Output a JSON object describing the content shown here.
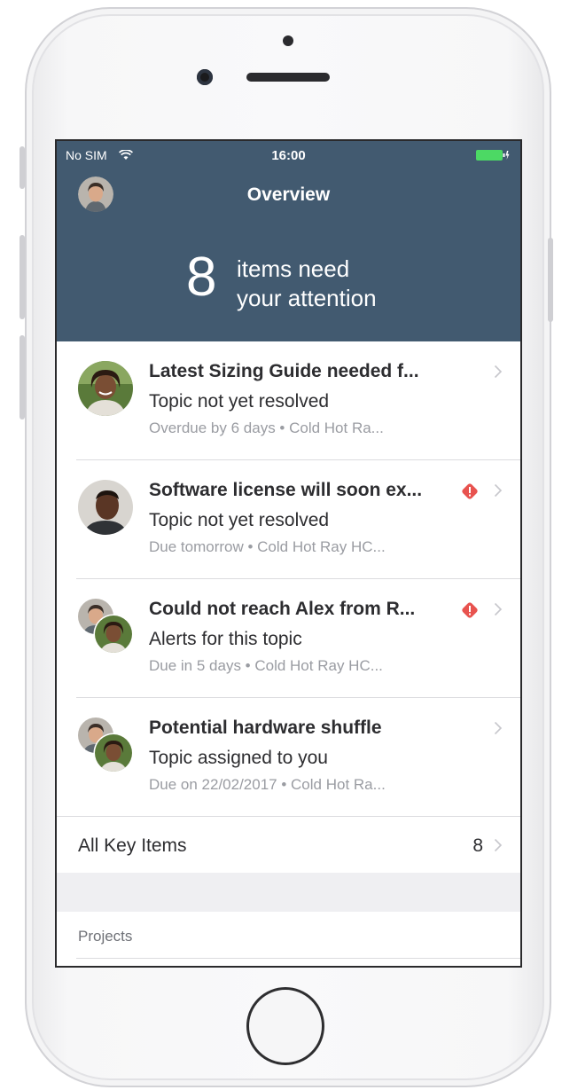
{
  "status_bar": {
    "carrier": "No SIM",
    "time": "16:00"
  },
  "nav": {
    "title": "Overview"
  },
  "attention": {
    "count": "8",
    "line1": "items need",
    "line2": "your attention"
  },
  "items": [
    {
      "title": "Latest Sizing Guide needed f...",
      "subtitle": "Topic not yet resolved",
      "meta": "Overdue by 6 days • Cold Hot Ra...",
      "alert": false
    },
    {
      "title": "Software license will soon ex...",
      "subtitle": "Topic not yet resolved",
      "meta": "Due tomorrow • Cold Hot Ray HC...",
      "alert": true
    },
    {
      "title": "Could not reach Alex from R...",
      "subtitle": "Alerts for this topic",
      "meta": "Due in 5 days • Cold Hot Ray HC...",
      "alert": true
    },
    {
      "title": "Potential hardware shuffle",
      "subtitle": "Topic assigned to you",
      "meta": "Due on 22/02/2017 • Cold Hot Ra...",
      "alert": false
    }
  ],
  "key_items": {
    "label": "All Key Items",
    "count": "8"
  },
  "projects": {
    "label": "Projects"
  },
  "colors": {
    "header": "#425a70",
    "alert": "#e8534f",
    "battery": "#4cd964"
  }
}
